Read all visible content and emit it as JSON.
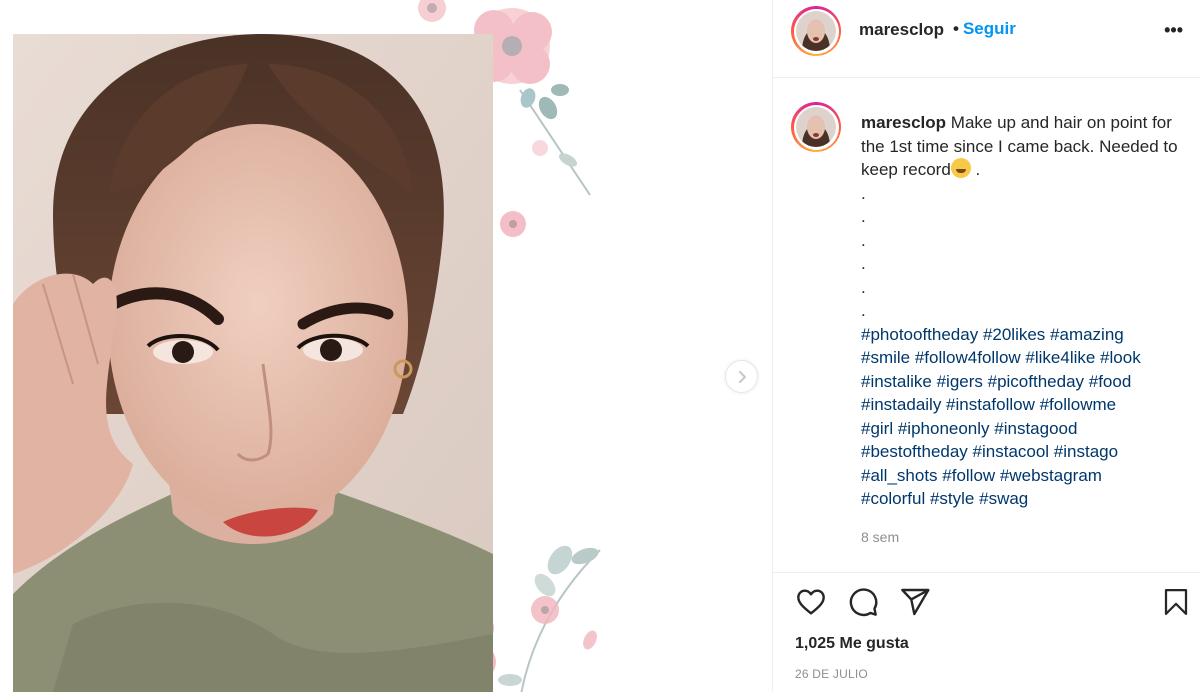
{
  "post": {
    "username": "maresclop",
    "follow_separator": "•",
    "follow_label": "Seguir",
    "more_label": "•••",
    "caption_text": "Make up and hair on point for the 1st time since I came back. Needed to keep record",
    "caption_after_emoji": " .",
    "caption_emoji": "rolling-on-floor-laughing-emoji",
    "caption_dots": [
      ".",
      ".",
      ".",
      ".",
      ".",
      "."
    ],
    "hashtags": [
      "#photooftheday #20likes #amazing",
      "#smile #follow4follow #like4like #look",
      "#instalike #igers #picoftheday #food",
      "#instadaily #instafollow #followme",
      "#girl #iphoneonly #instagood",
      "#bestoftheday #instacool #instago",
      "#all_shots #follow #webstagram",
      "#colorful #style #swag"
    ],
    "time_ago": "8 sem",
    "likes": "1,025 Me gusta",
    "date": "26 DE JULIO"
  },
  "icons": {
    "like": "heart-icon",
    "comment": "comment-icon",
    "share": "paper-plane-icon",
    "save": "bookmark-icon",
    "next": "chevron-right-icon"
  },
  "colors": {
    "link_blue": "#0095f6",
    "hashtag": "#00376b",
    "muted": "#8e8e8e",
    "text": "#262626"
  }
}
